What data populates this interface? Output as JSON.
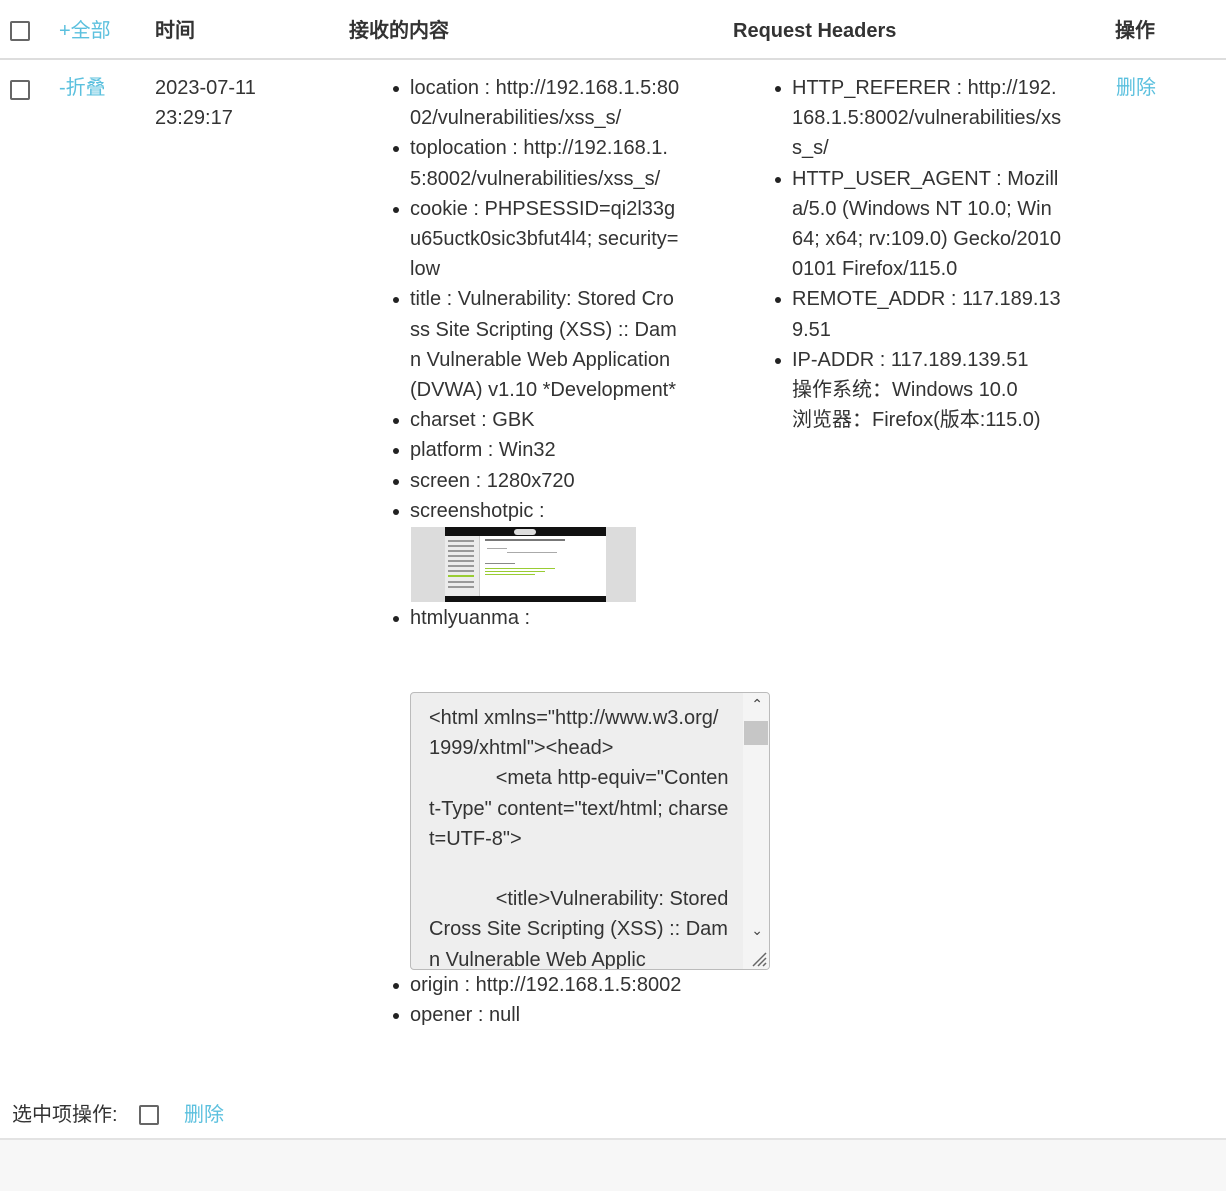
{
  "header": {
    "select_all": "+全部",
    "time": "时间",
    "content": "接收的内容",
    "request_headers": "Request Headers",
    "actions": "操作"
  },
  "row": {
    "toggle": "-折叠",
    "date": "2023-07-11",
    "time": "23:29:17",
    "delete": "删除",
    "content": {
      "location": {
        "key": "location",
        "value": "http://192.168.1.5:8002/vulnerabilities/xss_s/"
      },
      "toplocation": {
        "key": "toplocation",
        "value": "http://192.168.1.5:8002/vulnerabilities/xss_s/"
      },
      "cookie": {
        "key": "cookie",
        "value": "PHPSESSID=qi2l33gu65uctk0sic3bfut4l4; security=low"
      },
      "title": {
        "key": "title",
        "value": "Vulnerability: Stored Cross Site Scripting (XSS) :: Damn Vulnerable Web Application (DVWA) v1.10 *Development*"
      },
      "charset": {
        "key": "charset",
        "value": "GBK"
      },
      "platform": {
        "key": "platform",
        "value": "Win32"
      },
      "screen": {
        "key": "screen",
        "value": "1280x720"
      },
      "screenshotpic": {
        "key": "screenshotpic"
      },
      "htmlyuanma": {
        "key": "htmlyuanma",
        "value": "<html xmlns=\"http://www.w3.org/1999/xhtml\"><head>\n            <meta http-equiv=\"Content-Type\" content=\"text/html; charset=UTF-8\">\n\n            <title>Vulnerability: Stored Cross Site Scripting (XSS) :: Damn Vulnerable Web Applic"
      },
      "origin": {
        "key": "origin",
        "value": "http://192.168.1.5:8002"
      },
      "opener": {
        "key": "opener",
        "value": "null"
      }
    },
    "headers": {
      "referer": {
        "key": "HTTP_REFERER",
        "value": "http://192.168.1.5:8002/vulnerabilities/xss_s/"
      },
      "user_agent": {
        "key": "HTTP_USER_AGENT",
        "value": "Mozilla/5.0 (Windows NT 10.0; Win64; x64; rv:109.0) Gecko/20100101 Firefox/115.0"
      },
      "remote_addr": {
        "key": "REMOTE_ADDR",
        "value": "117.189.139.51"
      },
      "ip_addr": {
        "key": "IP-ADDR",
        "value": "117.189.139.51"
      },
      "os": "操作系统：Windows 10.0",
      "browser": "浏览器：Firefox(版本:115.0)"
    }
  },
  "bulk": {
    "label": "选中项操作:",
    "delete": "删除"
  }
}
